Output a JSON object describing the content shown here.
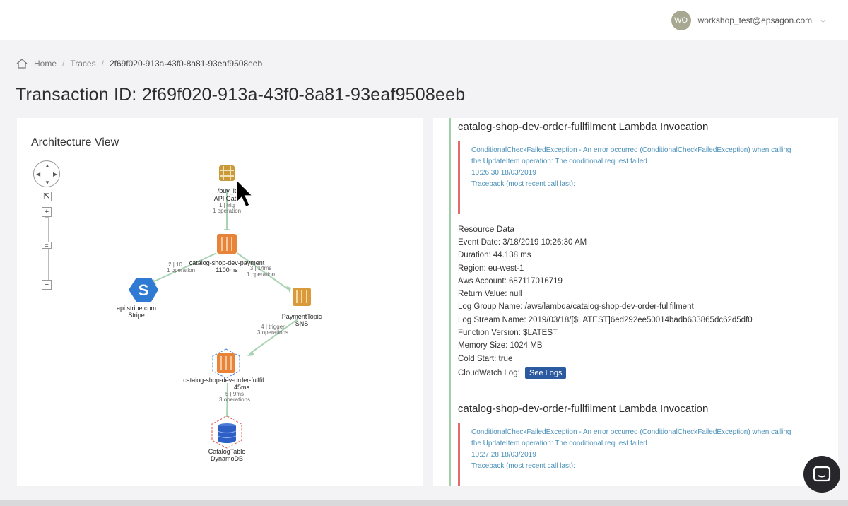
{
  "user": {
    "initials": "WO",
    "email": "workshop_test@epsagon.com"
  },
  "breadcrumb": {
    "home": "Home",
    "traces": "Traces",
    "current": "2f69f020-913a-43f0-8a81-93eaf9508eeb"
  },
  "page_title": "Transaction ID: 2f69f020-913a-43f0-8a81-93eaf9508eeb",
  "architecture": {
    "title": "Architecture View",
    "nodes": {
      "api": {
        "line1": "/buy_it",
        "line2": "API Gate",
        "line3": "1 | trig",
        "line4": "1 operation"
      },
      "payment": {
        "line1": "catalog-shop-dev-payment",
        "line2": "1100ms"
      },
      "stripe": {
        "line1": "api.stripe.com",
        "line2": "Stripe"
      },
      "sns": {
        "line1": "PaymentTopic",
        "line2": "SNS"
      },
      "fulfil": {
        "line1": "catalog-shop-dev-order-fullfil...",
        "line2": "45ms"
      },
      "dynamo": {
        "line1": "CatalogTable",
        "line2": "DynamoDB"
      }
    },
    "edges": {
      "stripe": {
        "line1": "2 | 10",
        "line2": "1 operation"
      },
      "sns": {
        "line1": "3 | 14ms",
        "line2": "1 operation"
      },
      "fulfil": {
        "line1": "4 | trigger",
        "line2": "3 operations"
      },
      "dynamo": {
        "line1": "5 | 9ms",
        "line2": "3 operations"
      }
    }
  },
  "details": {
    "invocation_1": {
      "title": "catalog-shop-dev-order-fullfilment Lambda Invocation",
      "error_line1": "ConditionalCheckFailedException - An error occurred (ConditionalCheckFailedException) when calling",
      "error_line2": "the UpdateItem operation: The conditional request failed",
      "timestamp": "10:26:30 18/03/2019",
      "traceback": "Traceback (most recent call last):"
    },
    "resource": {
      "title": "Resource Data",
      "event_date": "Event Date: 3/18/2019 10:26:30 AM",
      "duration": "Duration: 44.138 ms",
      "region": "Region: eu-west-1",
      "aws_account": "Aws Account: 687117016719",
      "return_value": "Return Value: null",
      "log_group": "Log Group Name: /aws/lambda/catalog-shop-dev-order-fullfilment",
      "log_stream": "Log Stream Name: 2019/03/18/[$LATEST]6ed292ee50014badb633865dc62d5df0",
      "function_version": "Function Version: $LATEST",
      "memory_size": "Memory Size: 1024 MB",
      "cold_start": "Cold Start: true",
      "cloudwatch_label": "CloudWatch Log:",
      "see_logs": "See Logs"
    },
    "invocation_2": {
      "title": "catalog-shop-dev-order-fullfilment Lambda Invocation",
      "error_line1": "ConditionalCheckFailedException - An error occurred (ConditionalCheckFailedException) when calling",
      "error_line2": "the UpdateItem operation: The conditional request failed",
      "timestamp": "10:27:28 18/03/2019",
      "traceback": "Traceback (most recent call last):"
    }
  },
  "colors": {
    "accent_blue": "#2c5aa0",
    "error_red": "#e36b6b",
    "rail_green": "#9fd0a9",
    "lambda_orange": "#e8833a"
  }
}
